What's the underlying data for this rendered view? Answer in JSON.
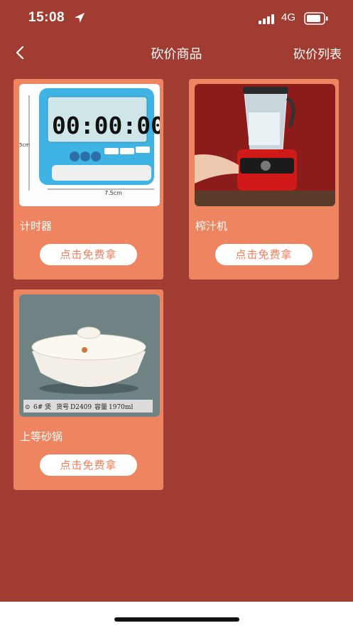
{
  "status_bar": {
    "time": "15:08",
    "network": "4G"
  },
  "nav": {
    "title": "砍价商品",
    "right_link": "砍价列表"
  },
  "products": [
    {
      "name": "计时器",
      "button": "点击免费拿",
      "image_text": {
        "display": "00:00:00",
        "dim_height": "5cm",
        "dim_width": "7.5cm"
      }
    },
    {
      "name": "榨汁机",
      "button": "点击免费拿"
    },
    {
      "name": "上等砂锅",
      "button": "点击免费拿",
      "image_text": {
        "size": "6# 煲",
        "model_label": "货号",
        "model": "D2409",
        "capacity_label": "容量",
        "capacity": "1970ml"
      }
    }
  ],
  "colors": {
    "background": "#a13c32",
    "card": "#ee8560",
    "button_text": "#ef7e5a"
  }
}
